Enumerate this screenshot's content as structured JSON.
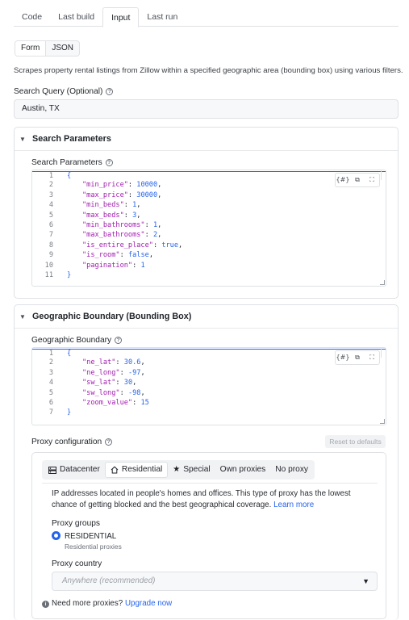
{
  "tabs": [
    {
      "label": "Code"
    },
    {
      "label": "Last build"
    },
    {
      "label": "Input"
    },
    {
      "label": "Last run"
    }
  ],
  "view_toggle": {
    "form": "Form",
    "json": "JSON"
  },
  "description": "Scrapes property rental listings from Zillow within a specified geographic area (bounding box) using various filters.",
  "search_query": {
    "label": "Search Query (Optional)",
    "value": "Austin, TX"
  },
  "search_section": {
    "title": "Search Parameters",
    "field_label": "Search Parameters",
    "lines": [
      {
        "n": "1",
        "text": "{"
      },
      {
        "n": "2",
        "key": "\"min_price\"",
        "val": "10000",
        "vtype": "n",
        "end": ","
      },
      {
        "n": "3",
        "key": "\"max_price\"",
        "val": "30000",
        "vtype": "n",
        "end": ","
      },
      {
        "n": "4",
        "key": "\"min_beds\"",
        "val": "1",
        "vtype": "n",
        "end": ","
      },
      {
        "n": "5",
        "key": "\"max_beds\"",
        "val": "3",
        "vtype": "n",
        "end": ","
      },
      {
        "n": "6",
        "key": "\"min_bathrooms\"",
        "val": "1",
        "vtype": "n",
        "end": ","
      },
      {
        "n": "7",
        "key": "\"max_bathrooms\"",
        "val": "2",
        "vtype": "n",
        "end": ","
      },
      {
        "n": "8",
        "key": "\"is_entire_place\"",
        "val": "true",
        "vtype": "b",
        "end": ","
      },
      {
        "n": "9",
        "key": "\"is_room\"",
        "val": "false",
        "vtype": "b",
        "end": ","
      },
      {
        "n": "10",
        "key": "\"pagination\"",
        "val": "1",
        "vtype": "n",
        "end": ""
      },
      {
        "n": "11",
        "text": "}"
      }
    ]
  },
  "geo_section": {
    "title": "Geographic Boundary (Bounding Box)",
    "field_label": "Geographic Boundary",
    "lines": [
      {
        "n": "1",
        "text": "{"
      },
      {
        "n": "2",
        "key": "\"ne_lat\"",
        "val": "30.6",
        "vtype": "n",
        "end": ","
      },
      {
        "n": "3",
        "key": "\"ne_long\"",
        "val": "-97",
        "vtype": "n",
        "end": ","
      },
      {
        "n": "4",
        "key": "\"sw_lat\"",
        "val": "30",
        "vtype": "n",
        "end": ","
      },
      {
        "n": "5",
        "key": "\"sw_long\"",
        "val": "-98",
        "vtype": "n",
        "end": ","
      },
      {
        "n": "6",
        "key": "\"zoom_value\"",
        "val": "15",
        "vtype": "n",
        "end": ""
      },
      {
        "n": "7",
        "text": "}"
      }
    ]
  },
  "editor_tools": {
    "format": "{#}",
    "copy": "⧉",
    "fullscreen": "⛶"
  },
  "proxy": {
    "label": "Proxy configuration",
    "reset": "Reset to defaults",
    "tabs": [
      {
        "label": "Datacenter",
        "icon": "server-icon"
      },
      {
        "label": "Residential",
        "icon": "home-icon"
      },
      {
        "label": "Special",
        "icon": "star-icon"
      },
      {
        "label": "Own proxies"
      },
      {
        "label": "No proxy"
      }
    ],
    "info": "IP addresses located in people's homes and offices. This type of proxy has the lowest chance of getting blocked and the best geographical coverage.",
    "learn_more": "Learn more",
    "groups_label": "Proxy groups",
    "group_name": "RESIDENTIAL",
    "group_desc": "Residential proxies",
    "country_label": "Proxy country",
    "country_placeholder": "Anywhere (recommended)",
    "more_text": "Need more proxies?",
    "upgrade": "Upgrade now"
  }
}
